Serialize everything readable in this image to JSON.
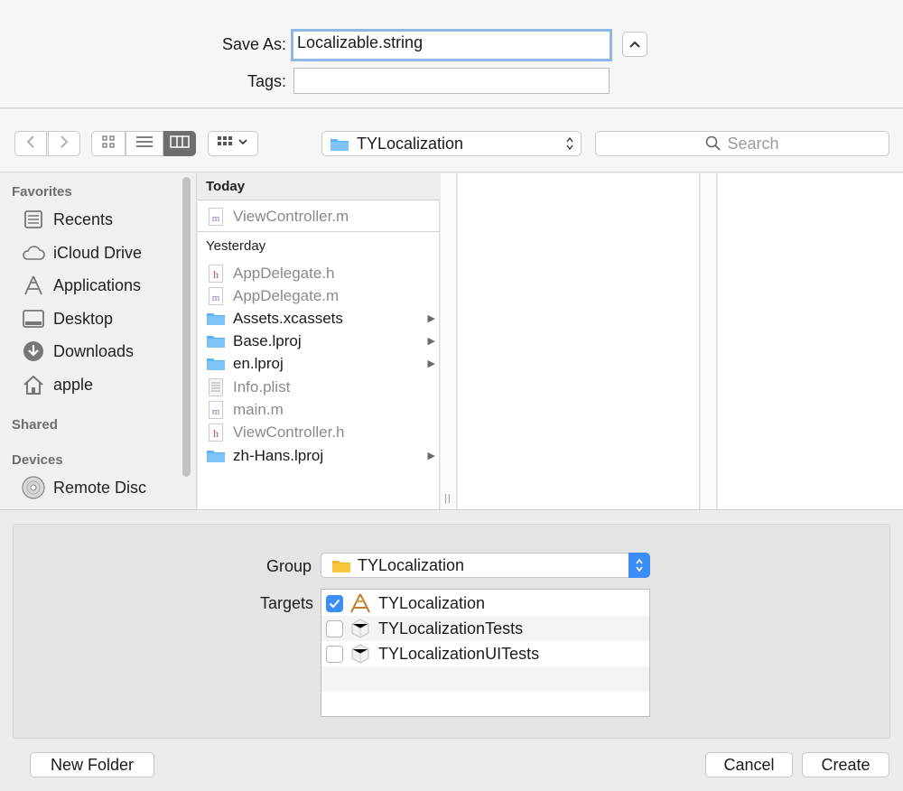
{
  "save": {
    "save_as_label": "Save As:",
    "filename": "Localizable.string",
    "tags_label": "Tags:",
    "tags_value": ""
  },
  "toolbar": {
    "location": "TYLocalization",
    "search_placeholder": "Search"
  },
  "sidebar": {
    "favorites_header": "Favorites",
    "shared_header": "Shared",
    "devices_header": "Devices",
    "favorites": [
      {
        "label": "Recents",
        "icon": "recents-icon"
      },
      {
        "label": "iCloud Drive",
        "icon": "cloud-icon"
      },
      {
        "label": "Applications",
        "icon": "applications-icon"
      },
      {
        "label": "Desktop",
        "icon": "desktop-icon"
      },
      {
        "label": "Downloads",
        "icon": "downloads-icon"
      },
      {
        "label": "apple",
        "icon": "home-icon"
      }
    ],
    "devices": [
      {
        "label": "Remote Disc",
        "icon": "disc-icon"
      }
    ]
  },
  "browser": {
    "today_header": "Today",
    "yesterday_header": "Yesterday",
    "today_files": [
      {
        "name": "ViewController.m",
        "kind": "m"
      }
    ],
    "yesterday_files": [
      {
        "name": "AppDelegate.h",
        "kind": "h"
      },
      {
        "name": "AppDelegate.m",
        "kind": "m"
      },
      {
        "name": "Assets.xcassets",
        "kind": "folder"
      },
      {
        "name": "Base.lproj",
        "kind": "folder"
      },
      {
        "name": "en.lproj",
        "kind": "folder"
      },
      {
        "name": "Info.plist",
        "kind": "plist"
      },
      {
        "name": "main.m",
        "kind": "m"
      },
      {
        "name": "ViewController.h",
        "kind": "h"
      },
      {
        "name": "zh-Hans.lproj",
        "kind": "folder"
      }
    ]
  },
  "options": {
    "group_label": "Group",
    "group_value": "TYLocalization",
    "targets_label": "Targets",
    "targets": [
      {
        "name": "TYLocalization",
        "checked": true
      },
      {
        "name": "TYLocalizationTests",
        "checked": false
      },
      {
        "name": "TYLocalizationUITests",
        "checked": false
      }
    ]
  },
  "buttons": {
    "new_folder": "New Folder",
    "cancel": "Cancel",
    "create": "Create"
  },
  "colors": {
    "accent": "#3b8ef5",
    "folder": "#5ab4f5",
    "group_folder": "#f8c73a"
  }
}
